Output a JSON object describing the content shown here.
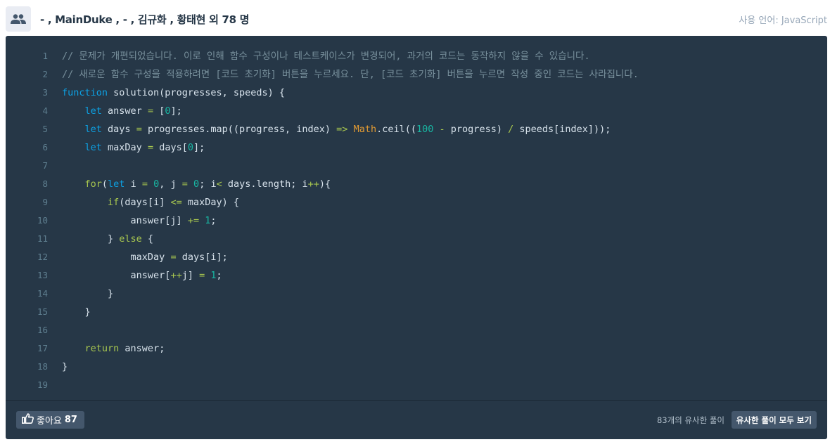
{
  "header": {
    "authors": "- , MainDuke , - , 김규화 , 황태현 외 78 명",
    "language": "사용 언어: JavaScript"
  },
  "code": {
    "lines": [
      {
        "n": "1",
        "tokens": [
          [
            "c-comment",
            "// 문제가 개편되었습니다. 이로 인해 함수 구성이나 테스트케이스가 변경되어, 과거의 코드는 동작하지 않을 수 있습니다."
          ]
        ]
      },
      {
        "n": "2",
        "tokens": [
          [
            "c-comment",
            "// 새로운 함수 구성을 적용하려면 [코드 초기화] 버튼을 누르세요. 단, [코드 초기화] 버튼을 누르면 작성 중인 코드는 사라집니다."
          ]
        ]
      },
      {
        "n": "3",
        "tokens": [
          [
            "c-kw",
            "function"
          ],
          [
            "",
            " solution(progresses, speeds) {"
          ]
        ]
      },
      {
        "n": "4",
        "tokens": [
          [
            "",
            "    "
          ],
          [
            "c-kw",
            "let"
          ],
          [
            "",
            " answer "
          ],
          [
            "c-op",
            "="
          ],
          [
            "",
            " ["
          ],
          [
            "c-num",
            "0"
          ],
          [
            "",
            "];"
          ]
        ]
      },
      {
        "n": "5",
        "tokens": [
          [
            "",
            "    "
          ],
          [
            "c-kw",
            "let"
          ],
          [
            "",
            " days "
          ],
          [
            "c-op",
            "="
          ],
          [
            "",
            " progresses.map((progress, index) "
          ],
          [
            "c-op",
            "=>"
          ],
          [
            "",
            " "
          ],
          [
            "c-cls",
            "Math"
          ],
          [
            "",
            ".ceil(("
          ],
          [
            "c-num",
            "100"
          ],
          [
            "",
            " "
          ],
          [
            "c-op",
            "-"
          ],
          [
            "",
            " progress) "
          ],
          [
            "c-op",
            "/"
          ],
          [
            "",
            " speeds[index]));"
          ]
        ]
      },
      {
        "n": "6",
        "tokens": [
          [
            "",
            "    "
          ],
          [
            "c-kw",
            "let"
          ],
          [
            "",
            " maxDay "
          ],
          [
            "c-op",
            "="
          ],
          [
            "",
            " days["
          ],
          [
            "c-num",
            "0"
          ],
          [
            "",
            "];"
          ]
        ]
      },
      {
        "n": "7",
        "tokens": [
          [
            "",
            ""
          ]
        ]
      },
      {
        "n": "8",
        "tokens": [
          [
            "",
            "    "
          ],
          [
            "c-kw2",
            "for"
          ],
          [
            "",
            "("
          ],
          [
            "c-kw",
            "let"
          ],
          [
            "",
            " i "
          ],
          [
            "c-op",
            "="
          ],
          [
            "",
            " "
          ],
          [
            "c-num",
            "0"
          ],
          [
            "",
            ", j "
          ],
          [
            "c-op",
            "="
          ],
          [
            "",
            " "
          ],
          [
            "c-num",
            "0"
          ],
          [
            "",
            "; i"
          ],
          [
            "c-op",
            "<"
          ],
          [
            "",
            " days.length; i"
          ],
          [
            "c-op",
            "++"
          ],
          [
            "",
            "){"
          ]
        ]
      },
      {
        "n": "9",
        "tokens": [
          [
            "",
            "        "
          ],
          [
            "c-kw2",
            "if"
          ],
          [
            "",
            "(days[i] "
          ],
          [
            "c-op",
            "<="
          ],
          [
            "",
            " maxDay) {"
          ]
        ]
      },
      {
        "n": "10",
        "tokens": [
          [
            "",
            "            answer[j] "
          ],
          [
            "c-op",
            "+="
          ],
          [
            "",
            " "
          ],
          [
            "c-num",
            "1"
          ],
          [
            "",
            ";"
          ]
        ]
      },
      {
        "n": "11",
        "tokens": [
          [
            "",
            "        } "
          ],
          [
            "c-kw2",
            "else"
          ],
          [
            "",
            " {"
          ]
        ]
      },
      {
        "n": "12",
        "tokens": [
          [
            "",
            "            maxDay "
          ],
          [
            "c-op",
            "="
          ],
          [
            "",
            " days[i];"
          ]
        ]
      },
      {
        "n": "13",
        "tokens": [
          [
            "",
            "            answer["
          ],
          [
            "c-op",
            "++"
          ],
          [
            "",
            "j] "
          ],
          [
            "c-op",
            "="
          ],
          [
            "",
            " "
          ],
          [
            "c-num",
            "1"
          ],
          [
            "",
            ";"
          ]
        ]
      },
      {
        "n": "14",
        "tokens": [
          [
            "",
            "        }"
          ]
        ]
      },
      {
        "n": "15",
        "tokens": [
          [
            "",
            "    }"
          ]
        ]
      },
      {
        "n": "16",
        "tokens": [
          [
            "",
            ""
          ]
        ]
      },
      {
        "n": "17",
        "tokens": [
          [
            "",
            "    "
          ],
          [
            "c-kw2",
            "return"
          ],
          [
            "",
            " answer;"
          ]
        ]
      },
      {
        "n": "18",
        "tokens": [
          [
            "",
            "}"
          ]
        ]
      },
      {
        "n": "19",
        "tokens": [
          [
            "",
            ""
          ]
        ]
      }
    ]
  },
  "footer": {
    "like_label": "좋아요",
    "like_count": "87",
    "similar_count": "83개의 유사한 풀이",
    "view_all_label": "유사한 풀이 모두 보기"
  },
  "icons": {
    "user_group": "people-icon",
    "thumbs_up": "thumbs-up-icon"
  },
  "colors": {
    "code_bg": "#263747",
    "keyword": "#0ca2e5",
    "control_keyword": "#a8c74f",
    "number": "#18b7a3",
    "comment": "#78909c"
  }
}
